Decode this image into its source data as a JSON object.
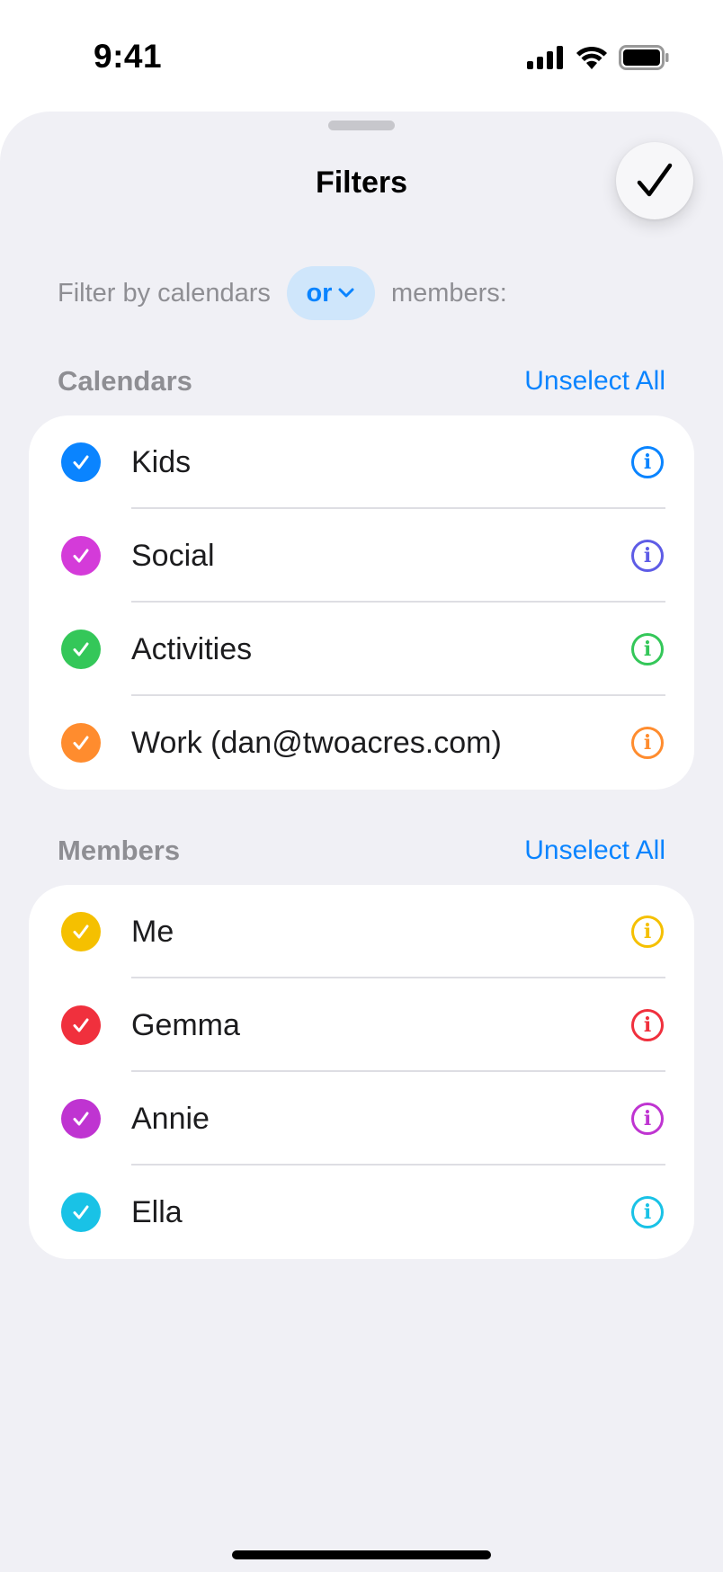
{
  "status_bar": {
    "time": "9:41"
  },
  "sheet": {
    "title": "Filters",
    "done_icon": "checkmark-icon",
    "filter_prefix": "Filter by calendars",
    "filter_operator": "or",
    "filter_suffix": "members:"
  },
  "calendars": {
    "title": "Calendars",
    "unselect_label": "Unselect All",
    "items": [
      {
        "label": "Kids",
        "checked": true,
        "color": "#0a84ff",
        "info_color": "#0a84ff"
      },
      {
        "label": "Social",
        "checked": true,
        "color": "#d43bd9",
        "info_color": "#5e5ce6"
      },
      {
        "label": "Activities",
        "checked": true,
        "color": "#34c759",
        "info_color": "#34c759"
      },
      {
        "label": "Work (dan@twoacres.com)",
        "checked": true,
        "color": "#ff8c2e",
        "info_color": "#ff8c2e"
      }
    ]
  },
  "members": {
    "title": "Members",
    "unselect_label": "Unselect All",
    "items": [
      {
        "label": "Me",
        "checked": true,
        "color": "#f5c000",
        "info_color": "#f5c000"
      },
      {
        "label": "Gemma",
        "checked": true,
        "color": "#f0303d",
        "info_color": "#f0303d"
      },
      {
        "label": "Annie",
        "checked": true,
        "color": "#bf34d1",
        "info_color": "#bf34d1"
      },
      {
        "label": "Ella",
        "checked": true,
        "color": "#19c2e6",
        "info_color": "#19c2e6"
      }
    ]
  }
}
